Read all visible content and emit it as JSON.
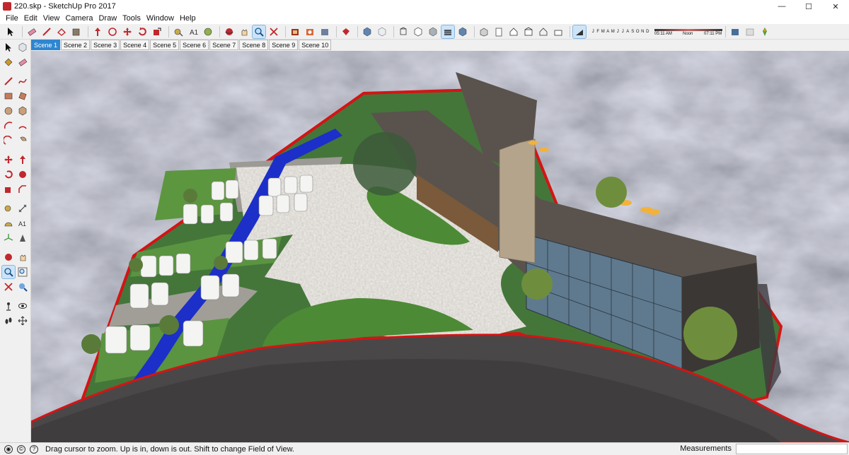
{
  "window": {
    "title": "220.skp - SketchUp Pro 2017",
    "minimize_glyph": "—",
    "maximize_glyph": "☐",
    "close_glyph": "✕"
  },
  "menu": [
    "File",
    "Edit",
    "View",
    "Camera",
    "Draw",
    "Tools",
    "Window",
    "Help"
  ],
  "toolbar": {
    "months_label": [
      "J",
      "F",
      "M",
      "A",
      "M",
      "J",
      "J",
      "A",
      "S",
      "O",
      "N",
      "D"
    ],
    "time_start": "05:11 AM",
    "time_noon": "Noon",
    "time_end": "07:11 PM"
  },
  "scenes": [
    "Scene 1",
    "Scene 2",
    "Scene 3",
    "Scene 4",
    "Scene 5",
    "Scene 6",
    "Scene 7",
    "Scene 8",
    "Scene 9",
    "Scene 10"
  ],
  "active_scene": "Scene 1",
  "status": {
    "hint": "Drag cursor to zoom.  Up is in, down is out. Shift to change Field of View.",
    "measurements_label": "Measurements",
    "measurements_value": ""
  },
  "colors": {
    "accent": "#2f86d0",
    "grass": "#4e8a3c",
    "water": "#1c2fc8",
    "road": "#4a4748",
    "boundary": "#d41414",
    "roof": "#5a534d"
  }
}
